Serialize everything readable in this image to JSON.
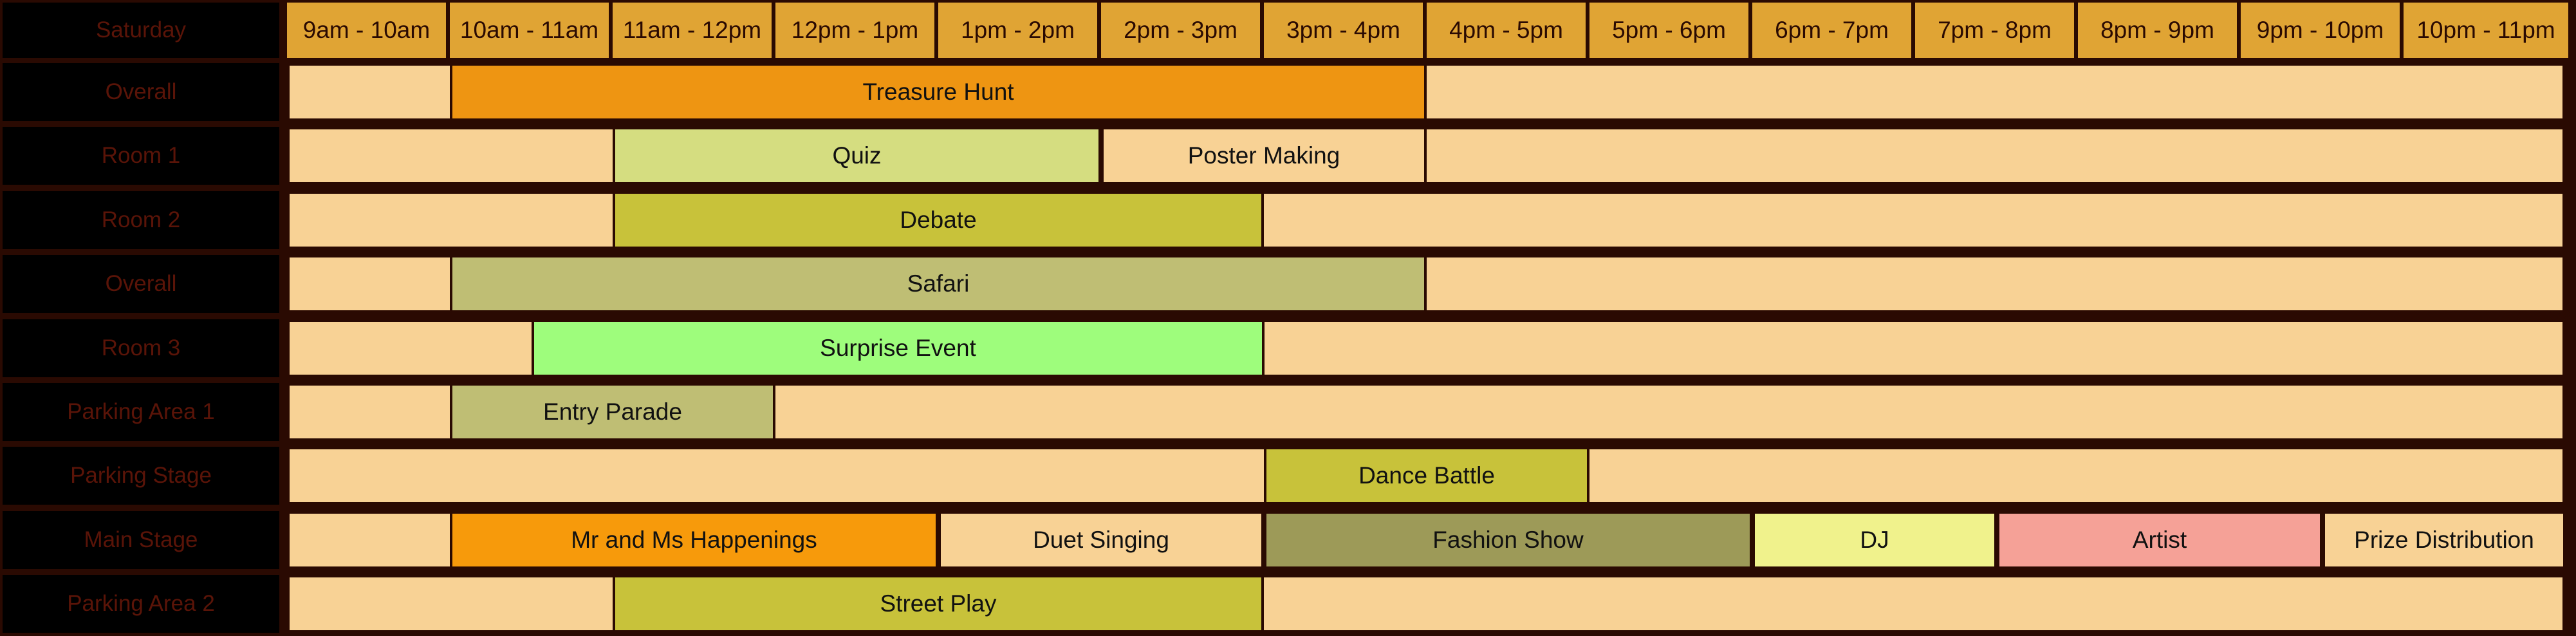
{
  "header": {
    "day_label": "Saturday",
    "slots": [
      "9am - 10am",
      "10am - 11am",
      "11am - 12pm",
      "12pm - 1pm",
      "1pm - 2pm",
      "2pm - 3pm",
      "3pm - 4pm",
      "4pm - 5pm",
      "5pm - 6pm",
      "6pm - 7pm",
      "7pm - 8pm",
      "8pm - 9pm",
      "9pm - 10pm",
      "10pm - 11pm"
    ]
  },
  "colors": {
    "background": "#2a0a02",
    "label_bg": "#000000",
    "label_text": "#5a1408",
    "header_bg": "#e0a434",
    "empty_slot": "#f8d295"
  },
  "rows": [
    {
      "label": "Overall",
      "events": [
        {
          "name": "Treasure Hunt",
          "start": 1,
          "end": 7,
          "color": "#ee9512"
        }
      ]
    },
    {
      "label": "Room 1",
      "events": [
        {
          "name": "Quiz",
          "start": 2,
          "end": 5,
          "color": "#d5dd80"
        },
        {
          "name": "Poster Making",
          "start": 5,
          "end": 7,
          "color": "#f8d295"
        }
      ]
    },
    {
      "label": "Room 2",
      "events": [
        {
          "name": "Debate",
          "start": 2,
          "end": 6,
          "color": "#c8c23a"
        }
      ]
    },
    {
      "label": "Overall",
      "events": [
        {
          "name": "Safari",
          "start": 1,
          "end": 7,
          "color": "#bfbe74"
        }
      ]
    },
    {
      "label": "Room 3",
      "events": [
        {
          "name": "Surprise Event",
          "start": 1.5,
          "end": 6,
          "color": "#9efd7c"
        }
      ]
    },
    {
      "label": "Parking Area 1",
      "events": [
        {
          "name": "Entry Parade",
          "start": 1,
          "end": 3,
          "color": "#bfbe74"
        }
      ]
    },
    {
      "label": "Parking Stage",
      "events": [
        {
          "name": "Dance Battle",
          "start": 6,
          "end": 8,
          "color": "#c8c23a"
        }
      ]
    },
    {
      "label": "Main Stage",
      "events": [
        {
          "name": "Mr and Ms Happenings",
          "start": 1,
          "end": 4,
          "color": "#f79a0b"
        },
        {
          "name": "Duet Singing",
          "start": 4,
          "end": 6,
          "color": "#f8d295"
        },
        {
          "name": "Fashion Show",
          "start": 6,
          "end": 9,
          "color": "#9d9a58"
        },
        {
          "name": "DJ",
          "start": 9,
          "end": 10.5,
          "color": "#f0f28c"
        },
        {
          "name": "Artist",
          "start": 10.5,
          "end": 12.5,
          "color": "#f5a197"
        },
        {
          "name": "Prize Distribution",
          "start": 12.5,
          "end": 14,
          "color": "#f8d295"
        }
      ]
    },
    {
      "label": "Parking Area 2",
      "events": [
        {
          "name": "Street Play",
          "start": 2,
          "end": 6,
          "color": "#c8c23a"
        }
      ]
    }
  ]
}
